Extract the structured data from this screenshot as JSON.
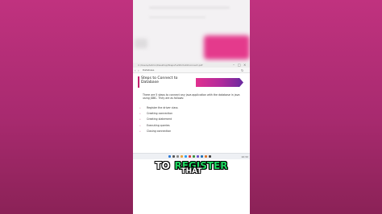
{
  "browser": {
    "url": "C:/Users/Admin/Desktop/Steps%20to%20Connect.pdf",
    "tab_label": "Database",
    "minimize": "–",
    "maximize": "□",
    "close": "×",
    "back_icon": "‹",
    "forward_icon": "›",
    "reload_icon": "↻"
  },
  "slide": {
    "title": "Steps to Connect to Database",
    "intro": "There are 5 steps to connect any java application with the database in java using JDBC. They are as follows:",
    "steps": [
      "Register the driver class",
      "Creating connection",
      "Creating statement",
      "Executing queries",
      "Closing connection"
    ],
    "bullet_char": "•",
    "accent_color": "#c2246e"
  },
  "taskbar": {
    "time": "10:32"
  },
  "caption": {
    "word1": "TO",
    "word2": "REGISTER",
    "word3": "THAT",
    "highlight_color": "#1ed760"
  }
}
